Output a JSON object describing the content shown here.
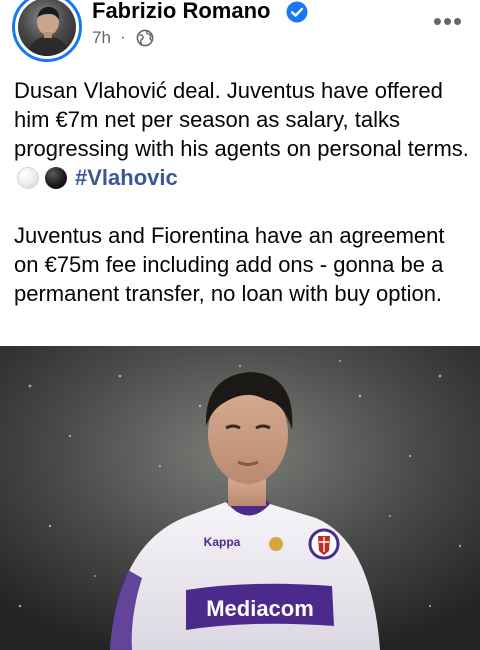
{
  "post": {
    "author": "Fabrizio Romano",
    "verified": true,
    "time": "7h",
    "separator": "·",
    "privacy_icon": "globe-icon",
    "more_icon": "more-dots-icon",
    "paragraph1": "Dusan Vlahović deal. Juventus have offered him €7m net per season as salary, talks progressing with his agents on personal terms.",
    "emojis": [
      "white-circle-emoji",
      "black-circle-emoji"
    ],
    "hashtag": "#Vlahovic",
    "paragraph2": "Juventus and Fiorentina have an agreement on €75m fee including add ons - gonna be a permanent transfer, no loan with buy option."
  },
  "photo": {
    "jersey_sponsor": "Mediacom",
    "jersey_brand": "Kappa"
  },
  "colors": {
    "accent": "#1877f2",
    "hashtag": "#385898",
    "meta": "#65676b",
    "jersey_purple": "#4b2a8c"
  }
}
